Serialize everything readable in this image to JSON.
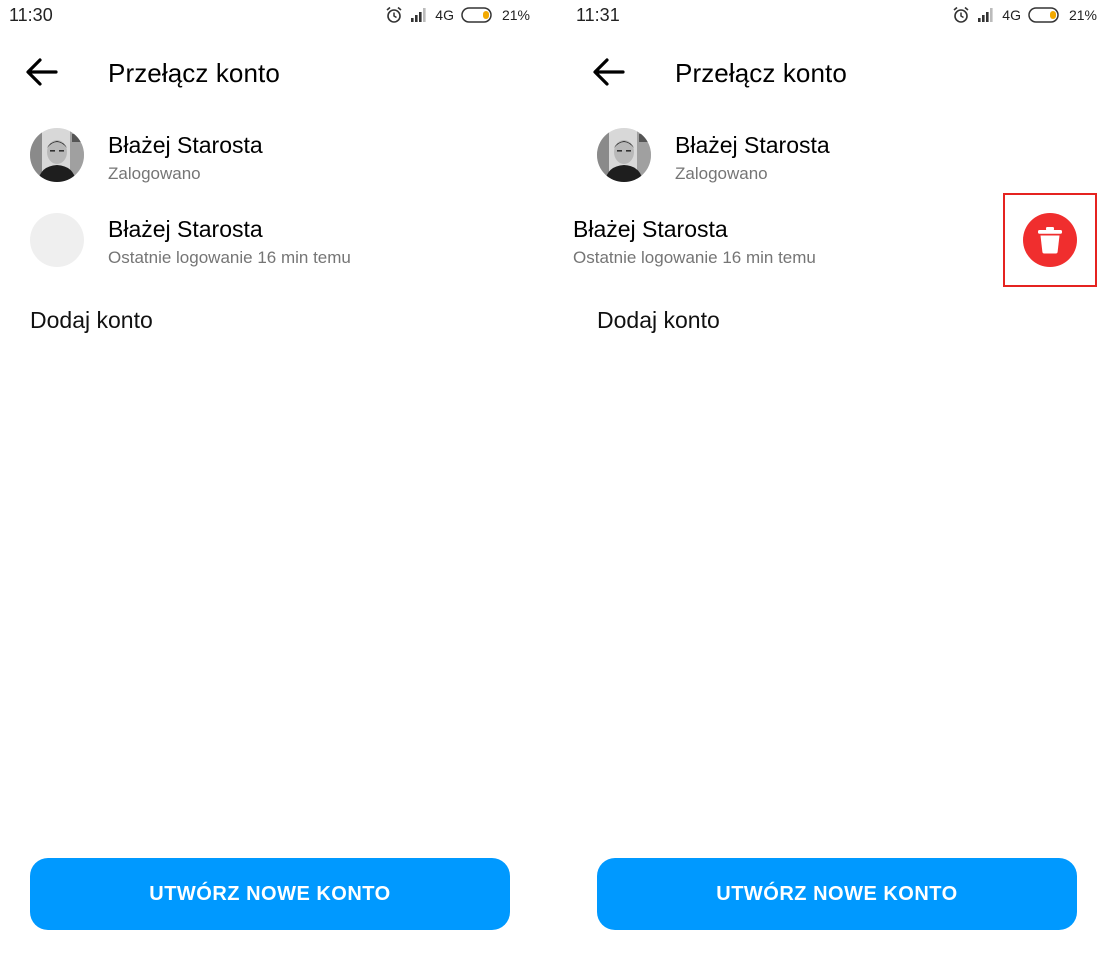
{
  "left": {
    "status": {
      "time": "11:30",
      "network": "4G",
      "battery": "21%"
    },
    "header": {
      "title": "Przełącz konto"
    },
    "accounts": [
      {
        "name": "Błażej Starosta",
        "subtitle": "Zalogowano"
      },
      {
        "name": "Błażej Starosta",
        "subtitle": "Ostatnie logowanie 16 min temu"
      }
    ],
    "add_account": "Dodaj konto",
    "create_button": "UTWÓRZ NOWE KONTO"
  },
  "right": {
    "status": {
      "time": "11:31",
      "network": "4G",
      "battery": "21%"
    },
    "header": {
      "title": "Przełącz konto"
    },
    "accounts": [
      {
        "name": "Błażej Starosta",
        "subtitle": "Zalogowano"
      },
      {
        "name": "Błażej Starosta",
        "subtitle": "Ostatnie logowanie 16 min temu"
      }
    ],
    "add_account": "Dodaj konto",
    "create_button": "UTWÓRZ NOWE KONTO"
  },
  "colors": {
    "accent": "#0099ff",
    "delete": "#f02e2e",
    "highlight": "#e52320",
    "subtitle": "#757575"
  },
  "icons": [
    "back-arrow-icon",
    "alarm-icon",
    "signal-icon",
    "battery-icon",
    "trash-icon"
  ]
}
